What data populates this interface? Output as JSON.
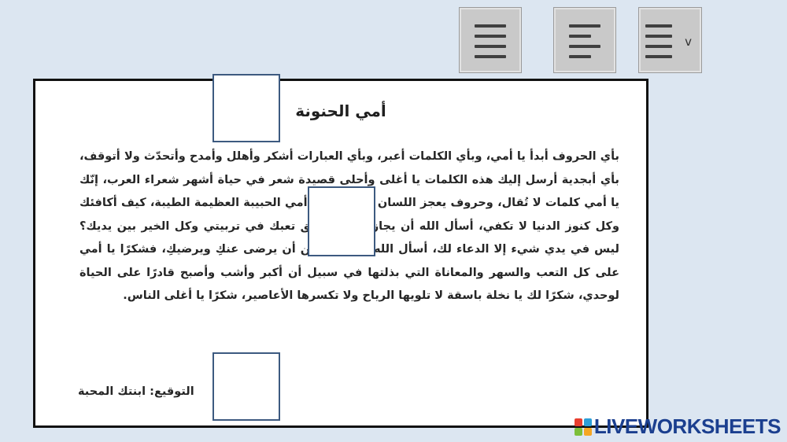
{
  "toolbar": {
    "align_buttons": [
      {
        "icon": "align-justify-icon"
      },
      {
        "icon": "align-left-icon"
      },
      {
        "icon": "align-dropdown-icon",
        "dropdown_label": "v"
      }
    ]
  },
  "worksheet": {
    "title": "أمي الحنونة",
    "paragraph": "بأي الحروف أبدأ يا أمي، وبأي الكلمات أعبر، وبأي العبارات أشكر وأهلل وأمدح وأتحدّث ولا أتوقف، بأي أبجدية أرسل إليك هذه الكلمات يا أغلى وأحلى قصيدة شعر في حياة أشهر شعراء العرب، إنّك يا أمي كلمات لا تُقال، وحروف يعجز اللسان عن نطقها، أمي الحبيبة العظيمة الطيبة، كيف أكافئك وكل كنوز الدنيا لا تكفي، أسأل الله أن يجازيك خيرًا بحق تعبك في تربيتي وكل الخير بين يديك؟ ليس في يدي شيء إلا الدعاء لك، أسأل الله رب العالمين أن يرضى عنكِ ويرضيكِ، فشكرًا يا أمي على كل التعب والسهر والمعاناة التي بذلتها في سبيل أن أكبر وأشب وأصبح قادرًا على الحياة لوحدي، شكرًا لك يا نخلة باسقة لا تلويها الرياح ولا تكسرها الأعاصير، شكرًا يا أغلى الناس.",
    "signature": "التوقيع: ابنتك المحبة"
  },
  "brand": {
    "name": "LIVEWORKSHEETS",
    "colors": [
      "#e83e2f",
      "#2d9fd8",
      "#7cbf3a",
      "#f5a623"
    ]
  },
  "colors": {
    "background": "#dce6f1",
    "box_border": "#3d5a80",
    "logo_text": "#1b3f8f"
  }
}
